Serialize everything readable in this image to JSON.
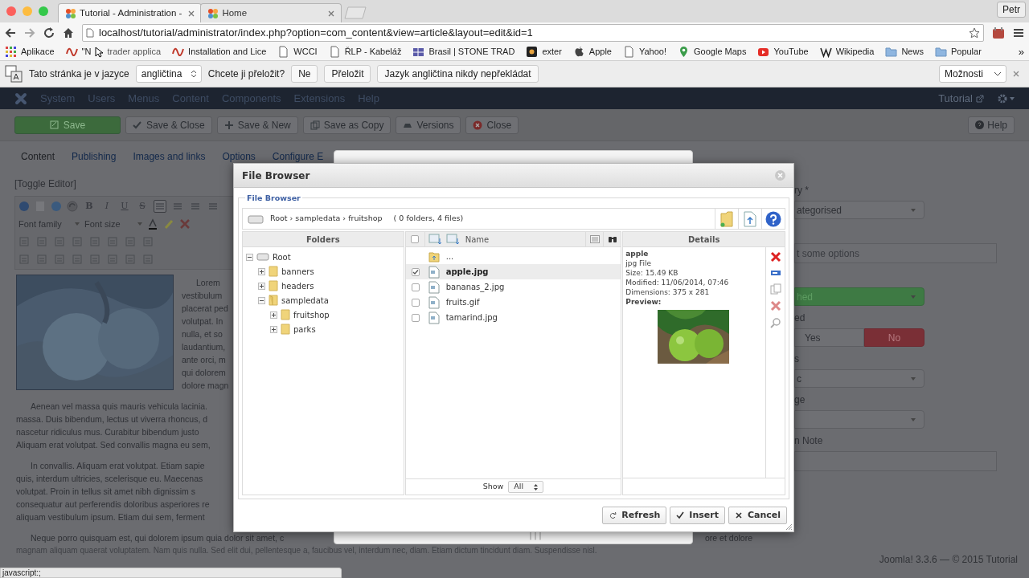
{
  "browser": {
    "tabs": [
      {
        "title": "Tutorial - Administration -",
        "selected": true
      },
      {
        "title": "Home",
        "selected": false
      }
    ],
    "user": "Petr",
    "url": "localhost/tutorial/administrator/index.php?option=com_content&view=article&layout=edit&id=1",
    "bookmarks": [
      {
        "label": "Aplikace",
        "kind": "apps"
      },
      {
        "label": "\"N",
        "label_after": "trader applica",
        "kind": "wave"
      },
      {
        "label": "Installation and Lice",
        "kind": "wave"
      },
      {
        "label": "WCCI",
        "kind": "page"
      },
      {
        "label": "ŘLP - Kabeláž",
        "kind": "page"
      },
      {
        "label": "Brasil | STONE TRAD",
        "kind": "grid"
      },
      {
        "label": "exter",
        "kind": "app"
      },
      {
        "label": "Apple",
        "kind": "apple"
      },
      {
        "label": "Yahoo!",
        "kind": "page"
      },
      {
        "label": "Google Maps",
        "kind": "maps"
      },
      {
        "label": "YouTube",
        "kind": "video"
      },
      {
        "label": "Wikipedia",
        "kind": "wiki"
      },
      {
        "label": "News",
        "kind": "folder"
      },
      {
        "label": "Popular",
        "kind": "folder"
      }
    ],
    "more": "»"
  },
  "translate_bar": {
    "prompt": "Tato stránka je v jazyce",
    "language": "angličtina",
    "question": "Chcete ji přeložit?",
    "buttons": [
      "Ne",
      "Přeložit",
      "Jazyk angličtina nikdy nepřekládat"
    ],
    "options": "Možnosti"
  },
  "joomla": {
    "menu": [
      "System",
      "Users",
      "Menus",
      "Content",
      "Components",
      "Extensions",
      "Help"
    ],
    "site_link": "Tutorial",
    "toolbar": [
      {
        "label": "Save",
        "kind": "save"
      },
      {
        "label": "Save & Close",
        "kind": "check"
      },
      {
        "label": "Save & New",
        "kind": "plus"
      },
      {
        "label": "Save as Copy",
        "kind": "copy"
      },
      {
        "label": "Versions",
        "kind": "versions"
      },
      {
        "label": "Close",
        "kind": "close"
      }
    ],
    "help": "Help",
    "tabs": [
      {
        "label": "Content",
        "selected": true
      },
      {
        "label": "Publishing",
        "selected": false
      },
      {
        "label": "Images and links",
        "selected": false
      },
      {
        "label": "Options",
        "selected": false
      },
      {
        "label": "Configure E",
        "selected": false
      }
    ],
    "editor": {
      "toggle": "[Toggle Editor]",
      "format_buttons": [
        {
          "label": "B",
          "kind": "bold"
        },
        {
          "label": "I",
          "kind": "italic"
        },
        {
          "label": "U",
          "kind": "underline"
        },
        {
          "label": "S",
          "kind": "strike"
        }
      ],
      "align_buttons": [
        {
          "selected": true
        },
        {
          "selected": false
        },
        {
          "selected": false
        },
        {
          "selected": false
        }
      ],
      "font_family": "Font family",
      "font_size": "Font size",
      "image_paragraph": [
        "Lorem",
        "vestibulum",
        "placerat ped",
        "volutpat. In",
        "nulla, et so",
        "laudantium,",
        "ante orci, m",
        "qui dolorem",
        "dolore magn"
      ],
      "paragraphs": [
        [
          "Aenean vel massa quis mauris vehicula lacinia.",
          "massa. Duis bibendum, lectus ut viverra rhoncus, d",
          "nascetur ridiculus mus. Curabitur bibendum justo",
          "Aliquam erat volutpat. Sed convallis magna eu sem,"
        ],
        [
          "In convallis. Aliquam erat volutpat. Etiam sapie",
          "quis, interdum ultricies, scelerisque eu. Maecenas",
          "volutpat. Proin in tellus sit amet nibh dignissim s",
          "consequatur aut perferendis doloribus asperiores re",
          "aliquam vestibulum ipsum. Etiam dui sem, ferment"
        ]
      ],
      "last_paragraph": {
        "left": "Neque porro quisquam est, qui dolorem ipsum quia dolor sit amet, c",
        "right": "ore et dolore",
        "next": "magnam aliquam quaerat voluptatem. Nam quis nulla. Sed elit dui, pellentesque a, faucibus vel, interdum nec, diam. Etiam dictum tincidunt diam. Suspendisse nisl."
      }
    },
    "form": [
      {
        "kind": "label",
        "text": "ry *"
      },
      {
        "kind": "select",
        "text": "ategorised"
      },
      {
        "kind": "gap"
      },
      {
        "kind": "input",
        "text": "t some options"
      },
      {
        "kind": "gap"
      },
      {
        "kind": "status",
        "text": "hed"
      },
      {
        "kind": "label",
        "text": "ed"
      },
      {
        "kind": "toggle",
        "options": [
          {
            "label": "Yes",
            "selected": false
          },
          {
            "label": "No",
            "selected": true
          }
        ]
      },
      {
        "kind": "label",
        "text": "s"
      },
      {
        "kind": "select",
        "text": "c"
      },
      {
        "kind": "label",
        "text": "ge"
      },
      {
        "kind": "select"
      },
      {
        "kind": "label",
        "text": "n Note"
      },
      {
        "kind": "input"
      }
    ],
    "footer": "Joomla! 3.3.6 — © 2015 Tutorial"
  },
  "file_browser": {
    "title": "File Browser",
    "legend": "File Browser",
    "path": "Root › sampledata › fruitshop",
    "summary": "( 0 folders, 4 files)",
    "folders_heading": "Folders",
    "tree": [
      {
        "label": "Root",
        "kind": "drive",
        "expanded": true,
        "children": [
          {
            "label": "banners",
            "expanded": false
          },
          {
            "label": "headers",
            "expanded": false
          },
          {
            "label": "sampledata",
            "expanded": true,
            "children": [
              {
                "label": "fruitshop",
                "expanded": false
              },
              {
                "label": "parks",
                "expanded": false
              }
            ]
          }
        ]
      }
    ],
    "all_checked": false,
    "name_heading": "Name",
    "files": [
      {
        "kind": "parent",
        "name": "...",
        "selected": false
      },
      {
        "kind": "file",
        "name": "apple.jpg",
        "checked": true,
        "selected": true
      },
      {
        "kind": "file",
        "name": "bananas_2.jpg",
        "checked": false,
        "selected": false
      },
      {
        "kind": "file",
        "name": "fruits.gif",
        "checked": false,
        "selected": false
      },
      {
        "kind": "file",
        "name": "tamarind.jpg",
        "checked": false,
        "selected": false
      }
    ],
    "show_label": "Show",
    "show_value": "All",
    "details_heading": "Details",
    "details": {
      "name": "apple",
      "type": "jpg File",
      "lines": [
        "Size: 15.49 KB",
        "Modified: 11/06/2014, 07:46",
        "Dimensions: 375 x 281"
      ],
      "preview_label": "Preview:"
    },
    "buttons": [
      {
        "label": "Refresh",
        "kind": "refresh"
      },
      {
        "label": "Insert",
        "kind": "insert"
      },
      {
        "label": "Cancel",
        "kind": "cancel"
      }
    ]
  },
  "status_bar": "javascript:;"
}
